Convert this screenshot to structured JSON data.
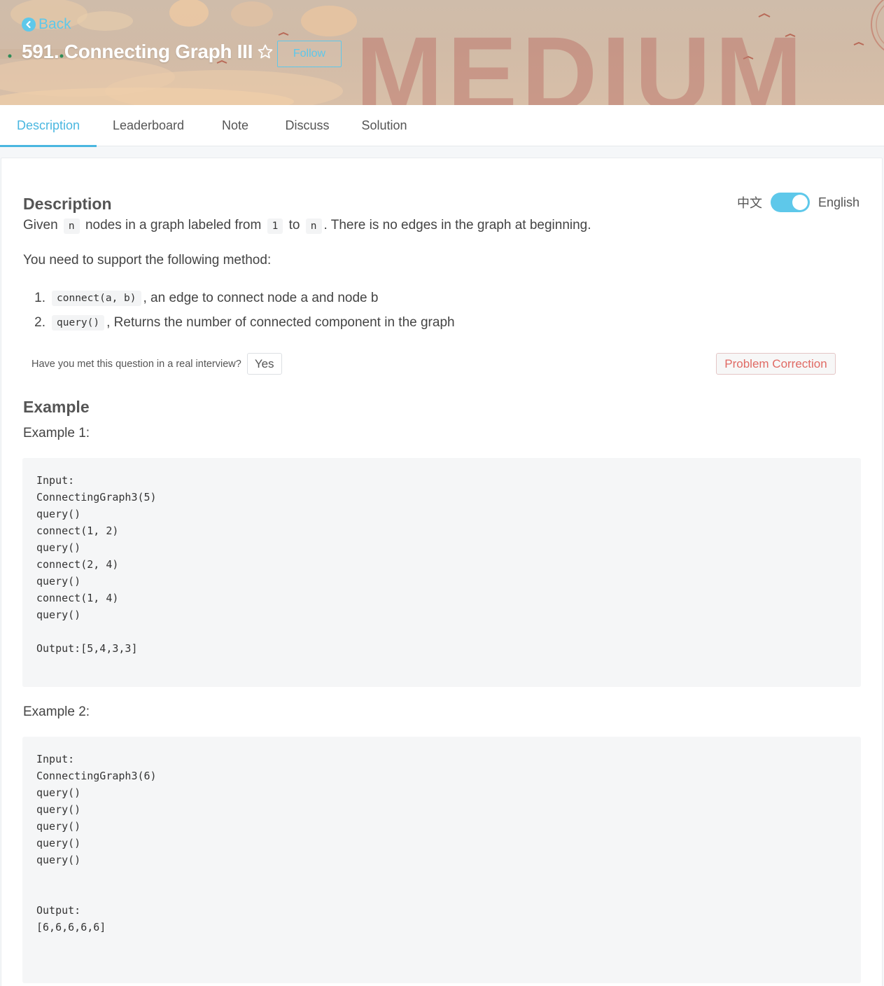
{
  "header": {
    "back_label": "Back",
    "title": "591. Connecting Graph III",
    "follow_label": "Follow",
    "difficulty_watermark": "MEDIUM"
  },
  "tabs": [
    {
      "label": "Description",
      "active": true
    },
    {
      "label": "Leaderboard",
      "active": false
    },
    {
      "label": "Note",
      "active": false
    },
    {
      "label": "Discuss",
      "active": false
    },
    {
      "label": "Solution",
      "active": false
    }
  ],
  "language_toggle": {
    "left_label": "中文",
    "right_label": "English",
    "state": "English"
  },
  "description": {
    "heading": "Description",
    "intro": {
      "t1": "Given",
      "c1": "n",
      "t2": "nodes in a graph labeled from",
      "c2": "1",
      "t3": "to",
      "c3": "n",
      "t4": ". There is no edges in the graph at beginning."
    },
    "support_text": "You need to support the following method:",
    "methods": [
      {
        "num": "1.",
        "code": "connect(a, b)",
        "text": ", an edge to connect node a and node b"
      },
      {
        "num": "2.",
        "code": "query()",
        "text": ", Returns the number of connected component in the graph"
      }
    ]
  },
  "interview": {
    "question": "Have you met this question in a real interview?",
    "yes_label": "Yes",
    "correction_label": "Problem Correction"
  },
  "example": {
    "heading": "Example",
    "ex1_label": "Example 1:",
    "ex1_code": "Input:\nConnectingGraph3(5)\nquery()\nconnect(1, 2)\nquery()\nconnect(2, 4)\nquery()\nconnect(1, 4)\nquery()\n\nOutput:[5,4,3,3]",
    "ex2_label": "Example 2:",
    "ex2_code": "Input:\nConnectingGraph3(6)\nquery()\nquery()\nquery()\nquery()\nquery()\n\n\nOutput:\n[6,6,6,6,6]"
  },
  "colors": {
    "accent": "#4ab7e0",
    "toggle": "#5ec8ea",
    "correction_text": "#e06a64",
    "watermark": "#be786e"
  }
}
